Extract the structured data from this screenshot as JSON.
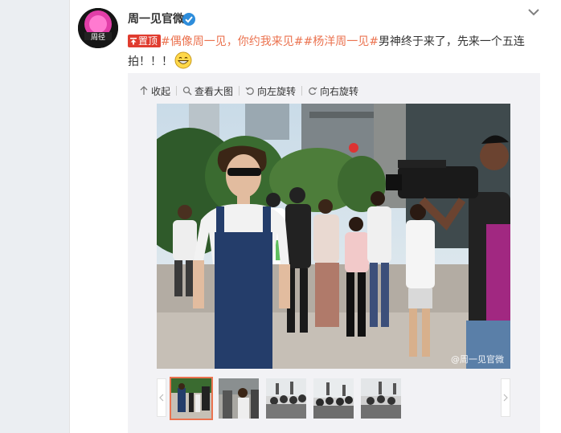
{
  "post": {
    "username": "周一见官微",
    "pin_badge": "置顶",
    "text_topic": "#偶像周一见，你约我来见##杨洋周一见#",
    "text_main": "男神终于来了，先来一个五连拍！！！"
  },
  "toolbar": {
    "collapse": "收起",
    "view_large": "查看大图",
    "rotate_left": "向左旋转",
    "rotate_right": "向右旋转"
  },
  "photo": {
    "watermark": "@周一见官微"
  },
  "avatar": {
    "label": "周径"
  },
  "colors": {
    "topic": "#eb7350",
    "pin": "#e03c2f",
    "verified": "#2e8ddb"
  },
  "thumbnails": [
    {
      "active": true
    },
    {
      "active": false
    },
    {
      "active": false
    },
    {
      "active": false
    },
    {
      "active": false
    }
  ]
}
